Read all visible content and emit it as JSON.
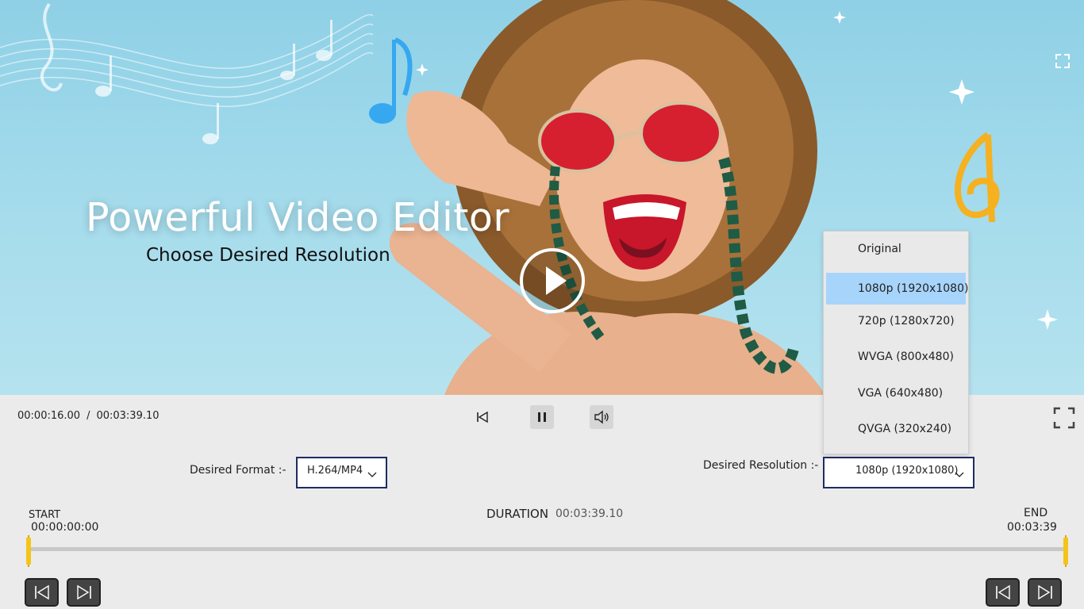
{
  "preview": {
    "headline": "Powerful Video Editor",
    "subheadline": "Choose Desired Resolution"
  },
  "playback": {
    "current_time": "00:00:16.00",
    "separator": "/",
    "total_time": "00:03:39.10"
  },
  "format": {
    "label": "Desired Format :-",
    "value": "H.264/MP4"
  },
  "resolution": {
    "label": "Desired Resolution :-",
    "value": "1080p (1920x1080)",
    "options": [
      "Original",
      "1080p (1920x1080)",
      "720p (1280x720)",
      "WVGA (800x480)",
      "VGA (640x480)",
      "QVGA (320x240)"
    ],
    "selected_index": 1
  },
  "timeline": {
    "duration_label": "DURATION",
    "duration_value": "00:03:39.10",
    "start_label": "START",
    "start_time": "00:00:00:00",
    "end_label": "END",
    "end_time": "00:03:39"
  },
  "colors": {
    "accent_border": "#1e2b63",
    "handle_yellow": "#f3c41b",
    "selected_option": "#a7d4fb"
  }
}
